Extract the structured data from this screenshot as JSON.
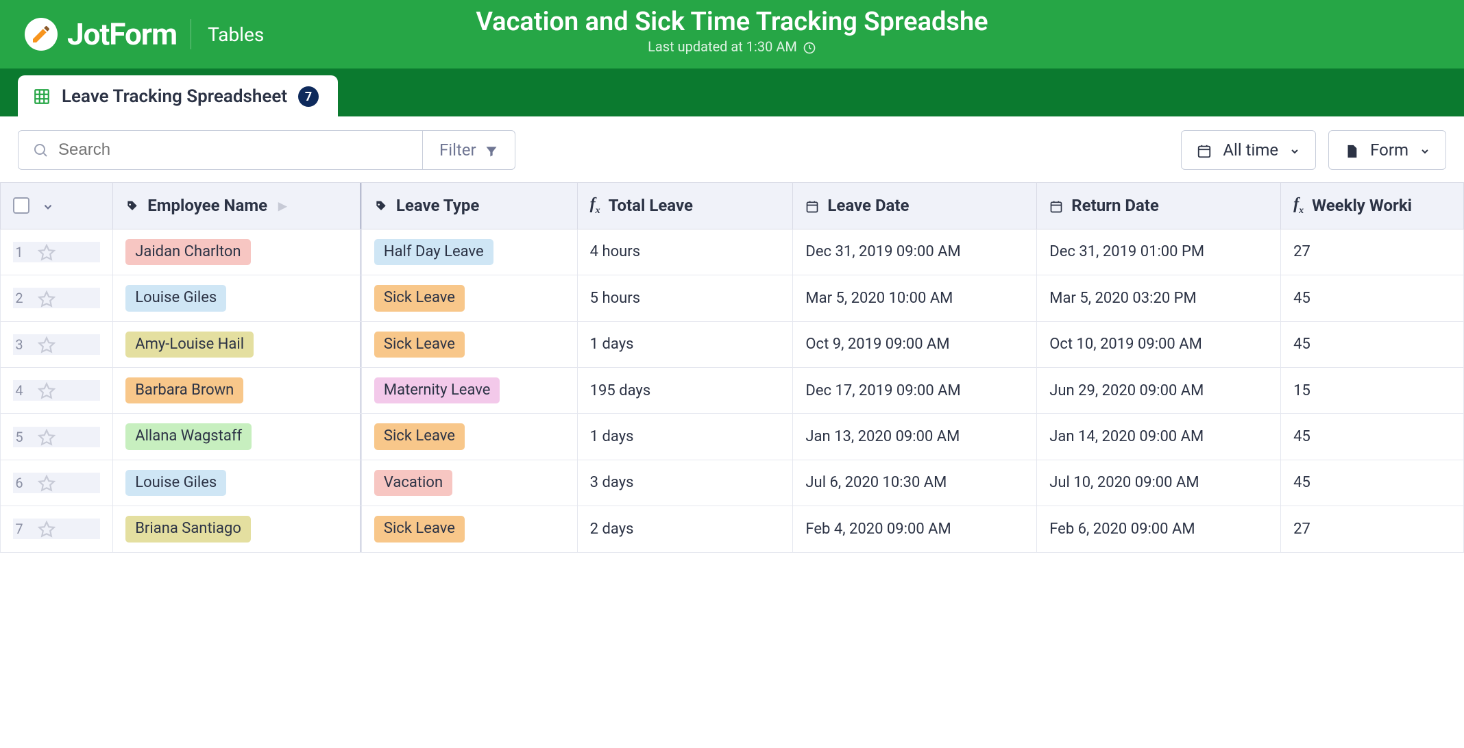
{
  "brand": {
    "name": "JotForm",
    "section": "Tables"
  },
  "page": {
    "title": "Vacation and Sick Time Tracking Spreadshe",
    "last_updated": "Last updated at 1:30 AM"
  },
  "tab": {
    "label": "Leave Tracking Spreadsheet",
    "count": "7"
  },
  "toolbar": {
    "search_placeholder": "Search",
    "filter_label": "Filter",
    "time_label": "All time",
    "form_label": "Form"
  },
  "columns": {
    "employee_name": "Employee Name",
    "leave_type": "Leave Type",
    "total_leave": "Total Leave",
    "leave_date": "Leave Date",
    "return_date": "Return Date",
    "weekly_working": "Weekly Worki"
  },
  "rows": [
    {
      "n": "1",
      "name": "Jaidan Charlton",
      "name_color": "chip-pink",
      "type": "Half Day Leave",
      "type_color": "chip-blue",
      "total": "4 hours",
      "leave": "Dec 31, 2019 09:00 AM",
      "return": "Dec 31, 2019 01:00 PM",
      "weekly": "27"
    },
    {
      "n": "2",
      "name": "Louise Giles",
      "name_color": "chip-blue",
      "type": "Sick Leave",
      "type_color": "chip-orange",
      "total": "5 hours",
      "leave": "Mar 5, 2020 10:00 AM",
      "return": "Mar 5, 2020 03:20 PM",
      "weekly": "45"
    },
    {
      "n": "3",
      "name": "Amy-Louise Hail",
      "name_color": "chip-khaki",
      "type": "Sick Leave",
      "type_color": "chip-orange",
      "total": "1 days",
      "leave": "Oct 9, 2019 09:00 AM",
      "return": "Oct 10, 2019 09:00 AM",
      "weekly": "45"
    },
    {
      "n": "4",
      "name": "Barbara Brown",
      "name_color": "chip-orange",
      "type": "Maternity Leave",
      "type_color": "chip-lpink",
      "total": "195 days",
      "leave": "Dec 17, 2019 09:00 AM",
      "return": "Jun 29, 2020 09:00 AM",
      "weekly": "15"
    },
    {
      "n": "5",
      "name": "Allana Wagstaff",
      "name_color": "chip-green",
      "type": "Sick Leave",
      "type_color": "chip-orange",
      "total": "1 days",
      "leave": "Jan 13, 2020 09:00 AM",
      "return": "Jan 14, 2020 09:00 AM",
      "weekly": "45"
    },
    {
      "n": "6",
      "name": "Louise Giles",
      "name_color": "chip-blue",
      "type": "Vacation",
      "type_color": "chip-pink",
      "total": "3 days",
      "leave": "Jul 6, 2020 10:30 AM",
      "return": "Jul 10, 2020 09:00 AM",
      "weekly": "45"
    },
    {
      "n": "7",
      "name": "Briana Santiago",
      "name_color": "chip-khaki",
      "type": "Sick Leave",
      "type_color": "chip-orange",
      "total": "2 days",
      "leave": "Feb 4, 2020 09:00 AM",
      "return": "Feb 6, 2020 09:00 AM",
      "weekly": "27"
    }
  ]
}
